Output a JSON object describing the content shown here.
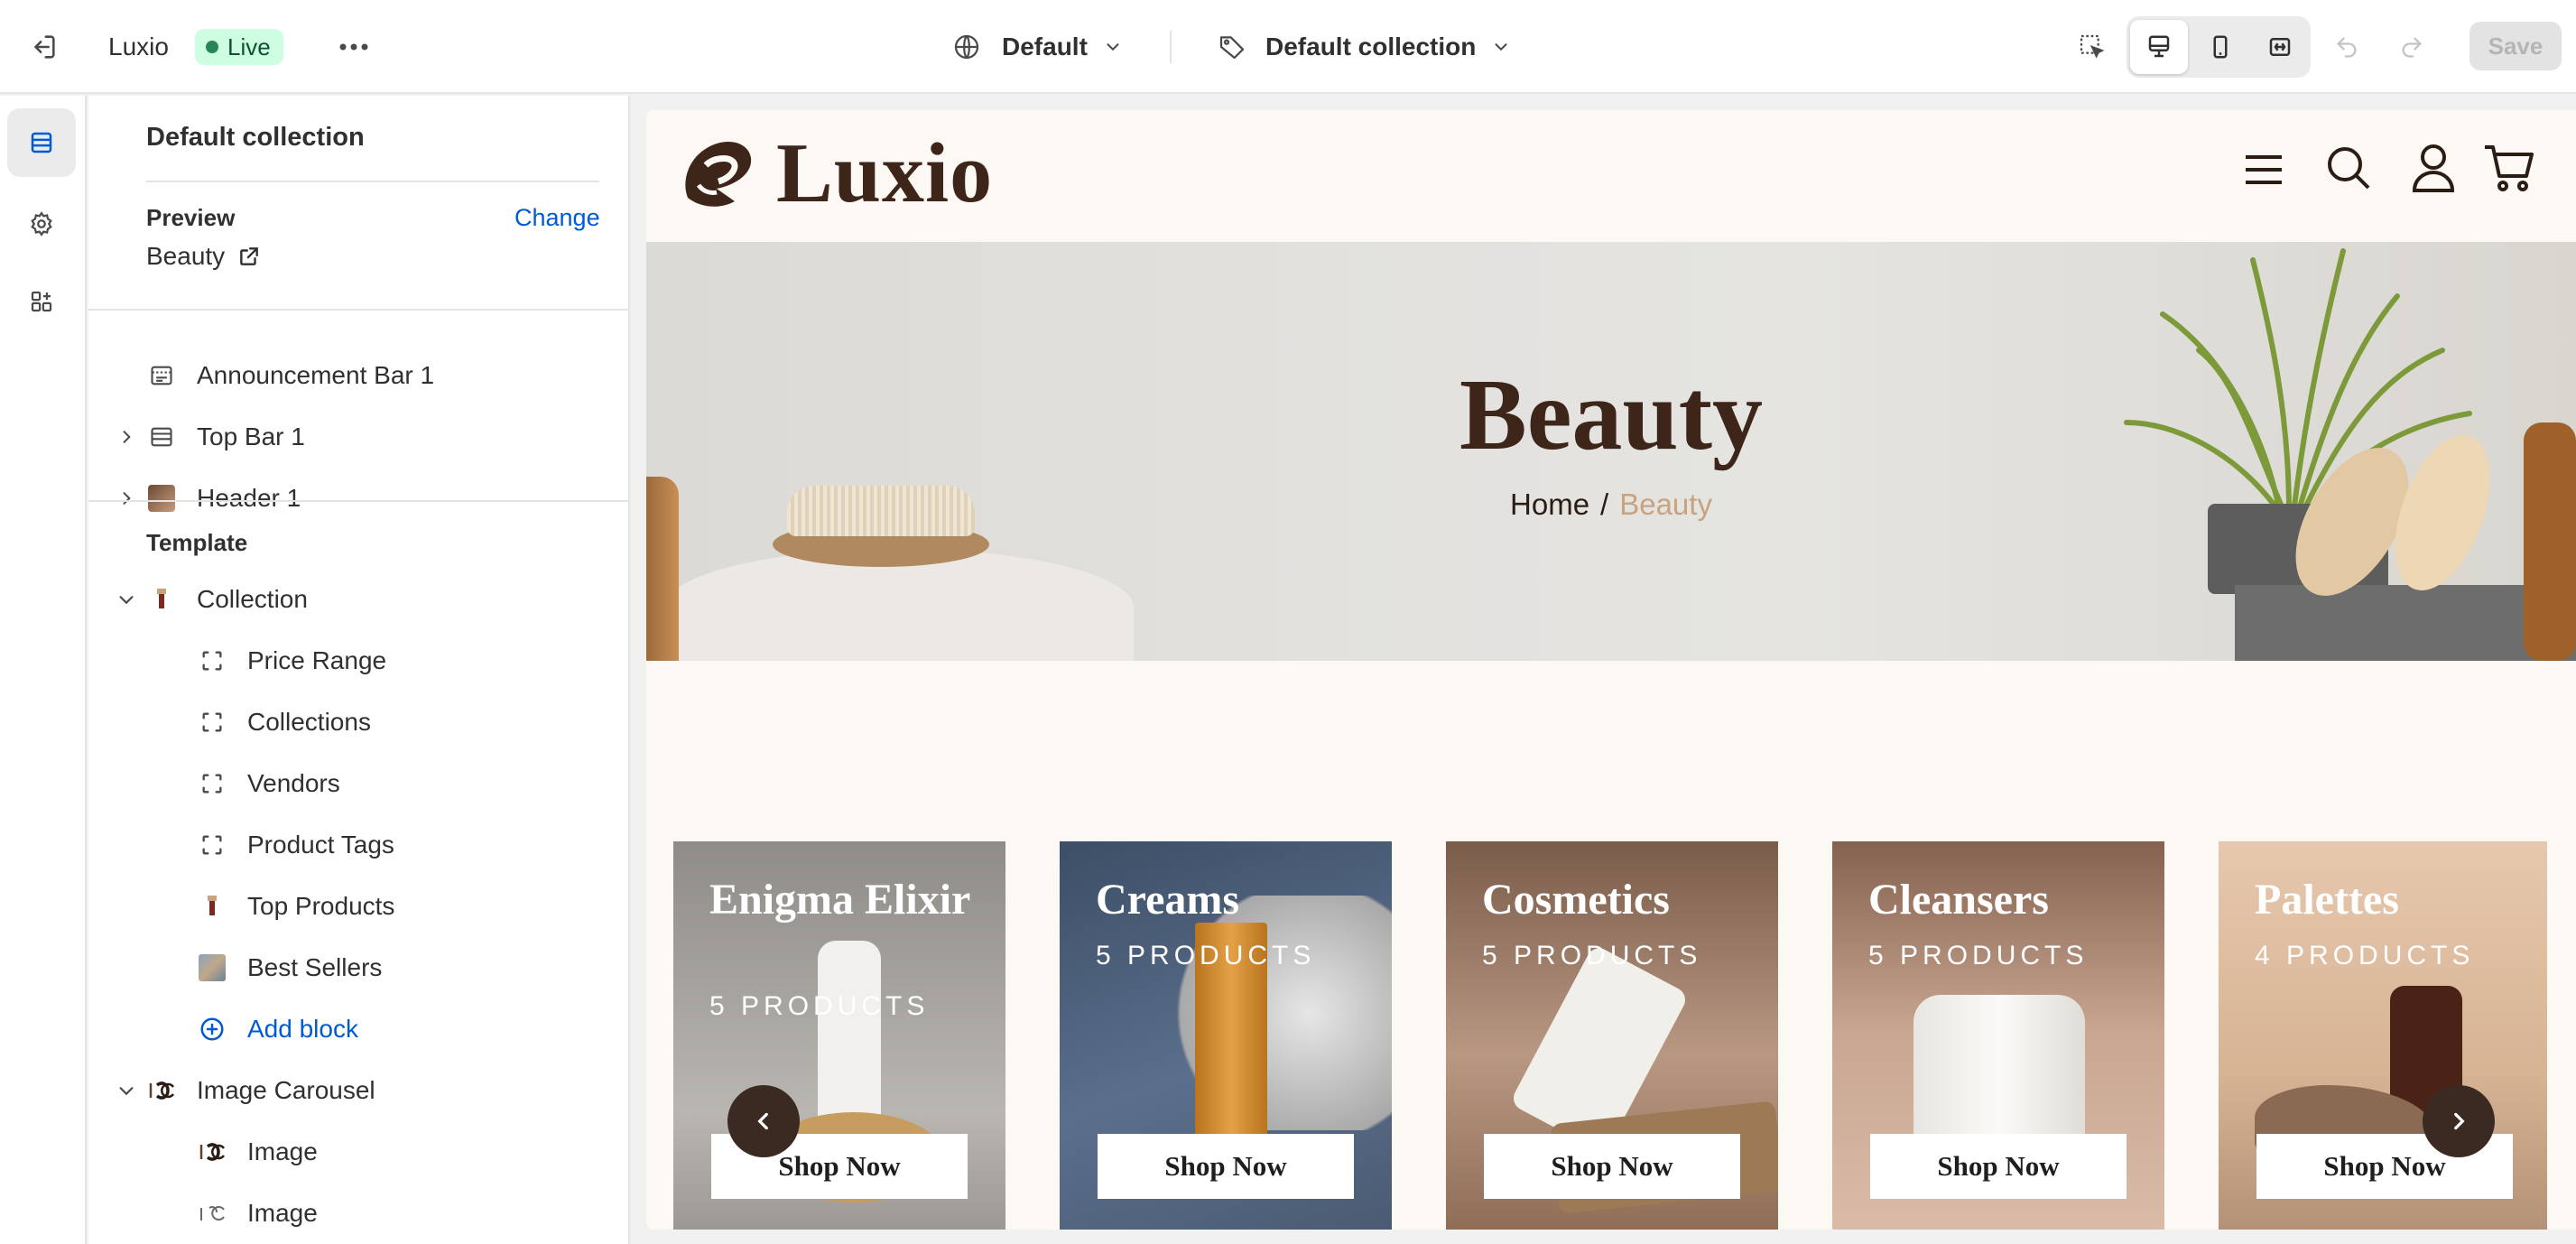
{
  "topbar": {
    "store_name": "Luxio",
    "live_badge": "Live",
    "theme_select": "Default",
    "template_select": "Default collection",
    "save_label": "Save"
  },
  "panel": {
    "title": "Default collection",
    "preview_label": "Preview",
    "change_link": "Change",
    "preview_value": "Beauty",
    "header_sections": [
      {
        "label": "Announcement Bar 1"
      },
      {
        "label": "Top Bar 1"
      },
      {
        "label": "Header 1"
      }
    ],
    "template_label": "Template",
    "template_items": [
      {
        "label": "Collection"
      },
      {
        "label": "Price Range"
      },
      {
        "label": "Collections"
      },
      {
        "label": "Vendors"
      },
      {
        "label": "Product Tags"
      },
      {
        "label": "Top Products"
      },
      {
        "label": "Best Sellers"
      },
      {
        "label": "Add block"
      },
      {
        "label": "Image Carousel"
      },
      {
        "label": "Image"
      },
      {
        "label": "Image"
      }
    ]
  },
  "store": {
    "logo_text": "Luxio",
    "hero_title": "Beauty",
    "breadcrumb_home": "Home",
    "breadcrumb_sep": "/",
    "breadcrumb_current": "Beauty",
    "cards": [
      {
        "title": "Enigma Elixir",
        "count": "5 PRODUCTS",
        "button": "Shop Now",
        "color": "#8f8c88"
      },
      {
        "title": "Creams",
        "count": "5 PRODUCTS",
        "button": "Shop Now",
        "color": "#4e5f75"
      },
      {
        "title": "Cosmetics",
        "count": "5 PRODUCTS",
        "button": "Shop Now",
        "color": "#7a5c4a"
      },
      {
        "title": "Cleansers",
        "count": "5 PRODUCTS",
        "button": "Shop Now",
        "color": "#85624f"
      },
      {
        "title": "Palettes",
        "count": "4 PRODUCTS",
        "button": "Shop Now",
        "color": "#b49277"
      }
    ]
  },
  "colors": {
    "accent_blue": "#005bd3",
    "live_green": "#29845a",
    "live_bg": "#cdfee1",
    "brand_brown": "#3e2519",
    "breadcrumb_current": "#c9a27f"
  }
}
